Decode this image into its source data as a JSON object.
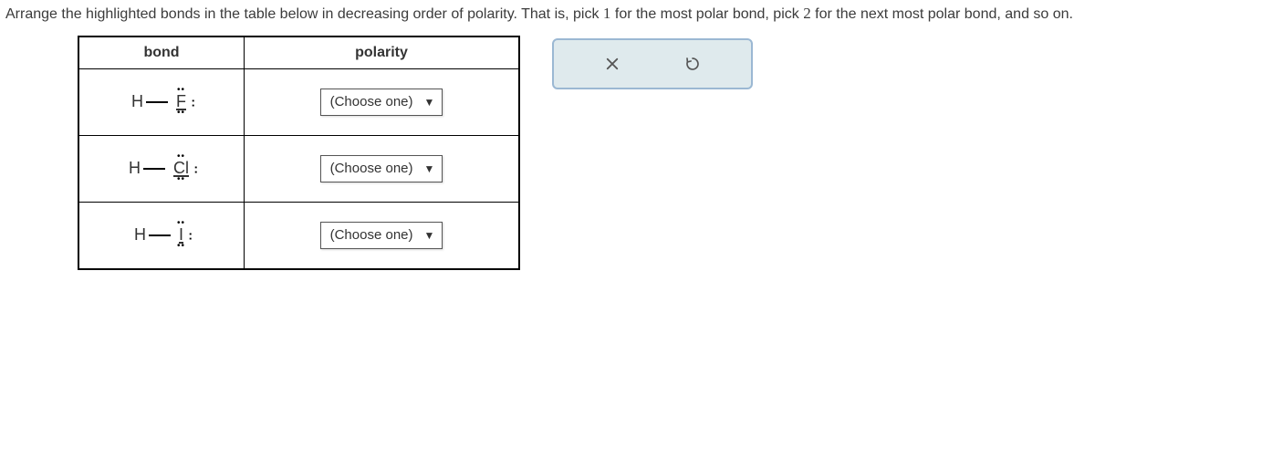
{
  "instructions": {
    "pre": "Arrange the highlighted bonds in the table below in decreasing order of polarity. That is, pick ",
    "rank1": "1",
    "mid": " for the most polar bond, pick ",
    "rank2": "2",
    "post": " for the next most polar bond, and so on."
  },
  "table": {
    "header_bond": "bond",
    "header_polarity": "polarity",
    "rows": [
      {
        "left_atom": "H",
        "right_atom": "F",
        "dropdown_placeholder": "(Choose one)"
      },
      {
        "left_atom": "H",
        "right_atom": "Cl",
        "dropdown_placeholder": "(Choose one)"
      },
      {
        "left_atom": "H",
        "right_atom": "I",
        "dropdown_placeholder": "(Choose one)"
      }
    ]
  },
  "actions": {
    "clear_label": "clear",
    "reset_label": "reset"
  }
}
